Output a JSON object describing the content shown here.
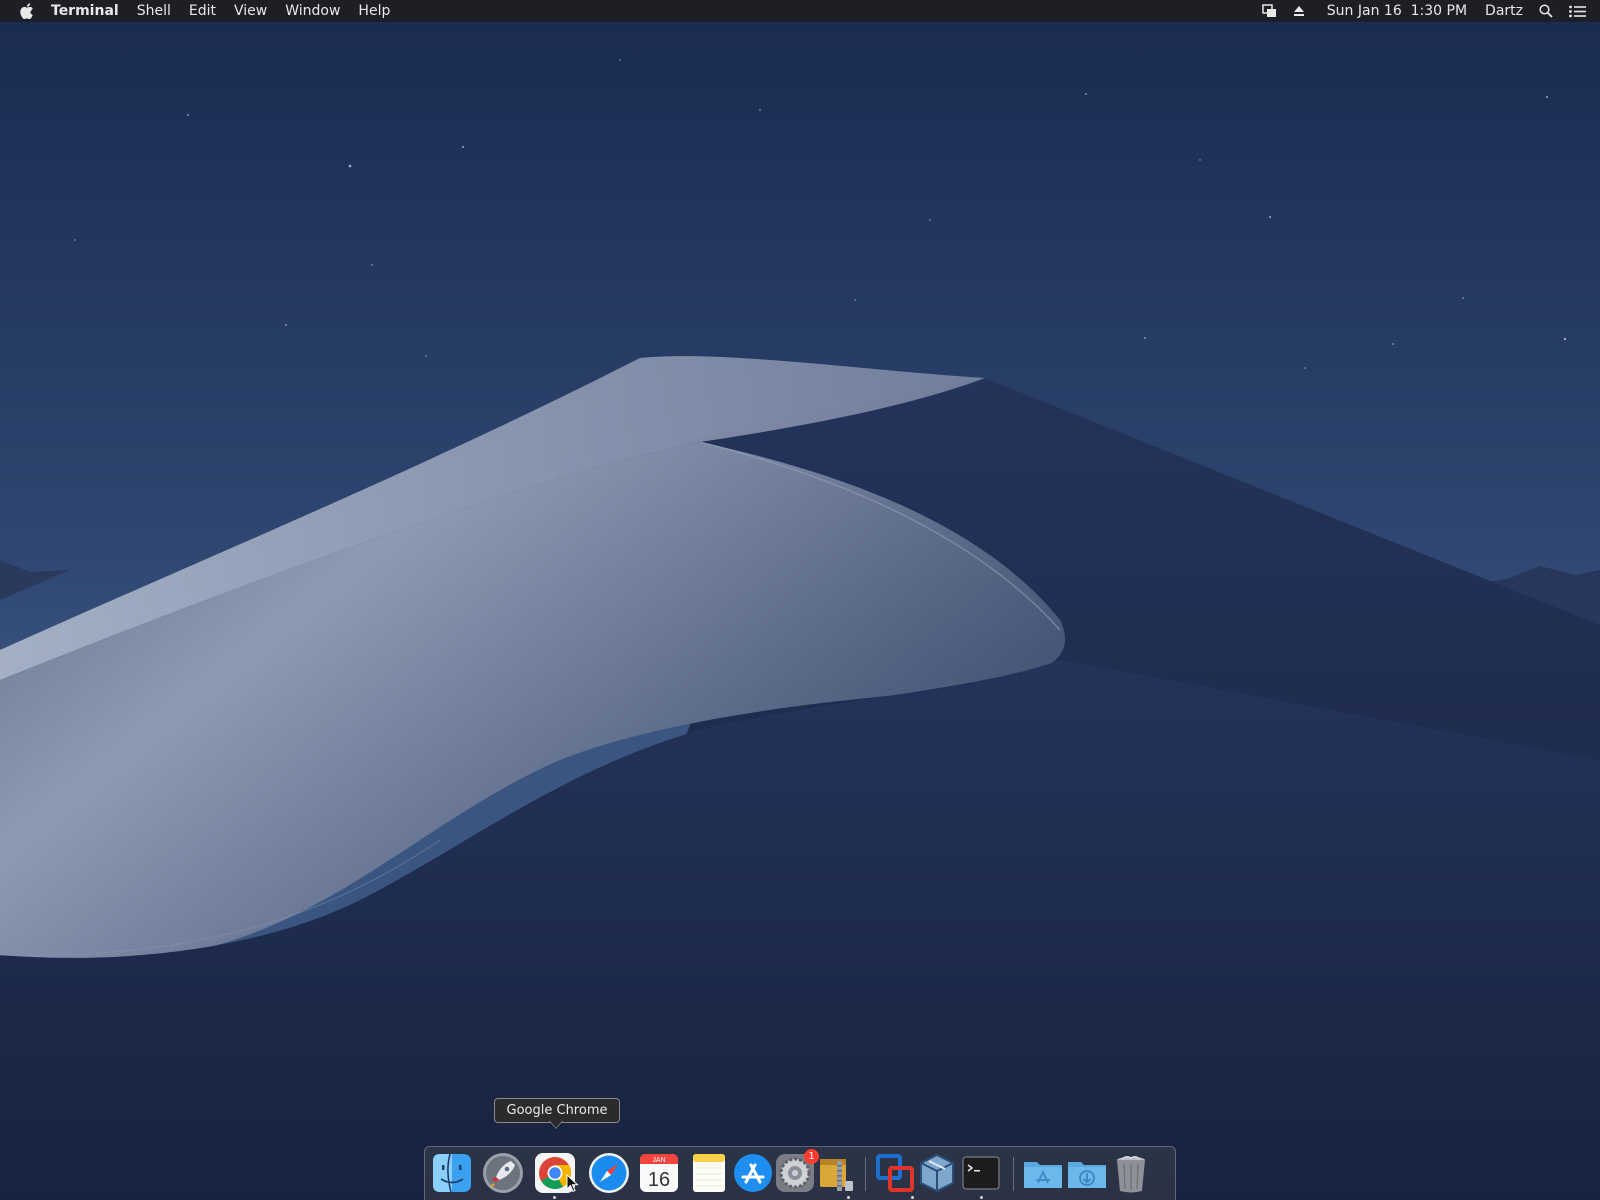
{
  "menubar": {
    "app_name": "Terminal",
    "menus": [
      "Shell",
      "Edit",
      "View",
      "Window",
      "Help"
    ],
    "clock": "Sun Jan 16  1:30 PM",
    "user": "Dartz"
  },
  "tooltip": {
    "text": "Google Chrome"
  },
  "dock": {
    "calendar_month": "JAN",
    "calendar_day": "16",
    "prefs_badge": "1"
  },
  "colors": {
    "sky_top": "#1c2c52",
    "sky_bottom": "#35507a",
    "dune_light": "#9aa6bc",
    "dune_dark": "#1d2b4f",
    "menubar": "#1e1e22"
  }
}
